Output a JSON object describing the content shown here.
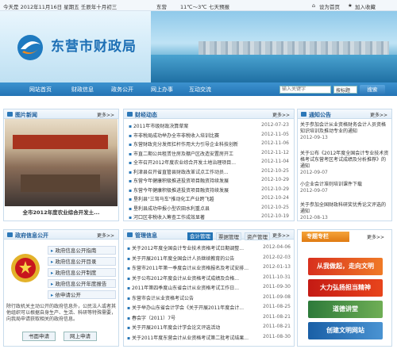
{
  "topbar": {
    "date": "今天是 2012年11月16日 星期五 壬辰年十月初三",
    "city": "东营",
    "temp": "11℃～3℃",
    "weather": "七天预报",
    "home": "设为首页",
    "fav": "加入收藏"
  },
  "site": {
    "title": "东营市财政局"
  },
  "nav": [
    "网站首页",
    "财政信息",
    "政务公开",
    "网上办事",
    "互动交流"
  ],
  "search": {
    "placeholder": "输入关键字",
    "scope": "按标题",
    "button": "搜索"
  },
  "more": "更多>>",
  "photo": {
    "title": "图片新闻",
    "caption": "全市2012年度农业综合开发土..."
  },
  "news": {
    "title": "财经动态",
    "items": [
      [
        "2011年市级财政决算草案",
        "2012-07-23"
      ],
      [
        "市非税局成功举办全市非税收入培训比赛",
        "2012-11-05"
      ],
      [
        "东营财政充分发挥扛杆作用大力引导企业科技创新",
        "2012-11-06"
      ],
      [
        "市直二期公共租赁住房及棚户区改造安置房开工",
        "2012-11-12"
      ],
      [
        "全市召开2012年度农业综合开发土地治理项目...",
        "2012-11-04"
      ],
      [
        "利津县召开省直管县财政改革试点工作动员...",
        "2012-10-25"
      ],
      [
        "东营今年健康积极推进投资项目融资持续发展",
        "2012-10-29"
      ],
      [
        "东营今年健康积极推进投资项目融资持续发展",
        "2012-10-29"
      ],
      [
        "垦利县\"三驾马车\"推动化工产业跨飞越",
        "2012-10-24"
      ],
      [
        "垦利县成功申报小型农田水利重点县",
        "2012-10-25"
      ],
      [
        "河口区非税收入筹查工作成效显著",
        "2012-10-19"
      ]
    ]
  },
  "notice": {
    "title": "通知公告",
    "items": [
      [
        "关于参加会计从业资格财务会计人员资格知识培训及推动专业的通知",
        "2012-09-13"
      ],
      [
        "关于公布《2012年度全国会计专业技术资格考试东营考区考试成绩及分析推荐》的通知",
        "2012-09-07"
      ],
      [
        "小企业会计准则培训课件下载",
        "2012-09-07"
      ],
      [
        "关于参加全国财政科研奖优秀论文评选的通知",
        "2012-08-13"
      ]
    ]
  },
  "gov": {
    "title": "政府信息公开",
    "items": [
      "政府信息公开指南",
      "政府信息公开目录",
      "政府信息公开制度",
      "政府信息公开年度报告",
      "依申请公开"
    ],
    "desc": "除行政机关主动公开的政府信息外，公民法人或者其他组织可以根据自身生产、生活、科研等特殊需要，向我局申请获取相关的政府信息。",
    "buttons": [
      "书面申请",
      "网上申请"
    ]
  },
  "manage": {
    "title": "管理信息",
    "tabs": [
      "会计管理",
      "票据管理",
      "资产管理"
    ],
    "items": [
      [
        "关于2012年度全国会计专业技术资格考试日期调整...",
        "2012-04-06"
      ],
      [
        "关于开展2011年度全国会计人员继续教育的公告",
        "2012-02-03"
      ],
      [
        "东营市2011年第一季度会计从业资格报名及考试安排...",
        "2012-01-13"
      ],
      [
        "关于公布2012年度会计从业资格考试成绩及合格...",
        "2011-10-31"
      ],
      [
        "2011年第四季度山东省会计从业资格考试工作日...",
        "2011-09-30"
      ],
      [
        "东营市会计从业资格考试公告",
        "2011-09-08"
      ],
      [
        "关于举办山东省会计学会《关于开展2011年度会计...",
        "2011-08-25"
      ],
      [
        "春会字（2011）7号",
        "2011-08-21"
      ],
      [
        "关于开展2011年度会计学会论文评选活动",
        "2011-08-21"
      ],
      [
        "关于2011年度东营会计从业资格考试第二批考试结果...",
        "2011-08-30"
      ]
    ]
  },
  "special": {
    "title": "专题专栏",
    "items": [
      "从我做起，走向文明",
      "大力弘扬担当精神",
      "道德讲堂",
      "创建文明网站"
    ]
  }
}
